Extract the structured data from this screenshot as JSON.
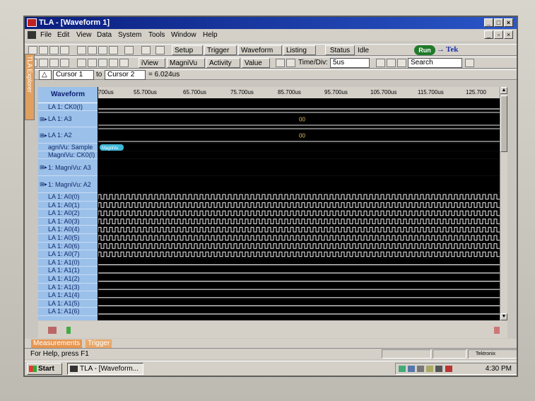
{
  "window": {
    "title": "TLA - [Waveform 1]"
  },
  "menu": [
    "File",
    "Edit",
    "View",
    "Data",
    "System",
    "Tools",
    "Window",
    "Help"
  ],
  "toolbar1": {
    "setup": "Setup",
    "trigger": "Trigger",
    "waveform": "Waveform",
    "listing": "Listing",
    "status_button": "Status",
    "status_text": "Idle",
    "run": "Run",
    "brand": "Tek"
  },
  "toolbar2": {
    "iview": "iView",
    "magnivu": "MagniVu",
    "activity": "Activity",
    "value": "Value",
    "timediv_label": "Time/Div:",
    "timediv_value": "5us",
    "search": "Search"
  },
  "toolbar3": {
    "cursor1": "Cursor 1",
    "to": "to",
    "cursor2": "Cursor 2",
    "delta": "= 6.024us"
  },
  "explorer_tab": "TLA Explorer",
  "waveform": {
    "header": "Waveform",
    "ticks": [
      "700us",
      "55.700us",
      "65.700us",
      "75.700us",
      "85.700us",
      "95.700us",
      "105.700us",
      "115.700us",
      "125.700"
    ],
    "rows": [
      {
        "label": "LA 1: CK0(I)",
        "kind": "line",
        "h": 11
      },
      {
        "label": "LA 1: A3",
        "kind": "bus",
        "value": "00",
        "h": 23,
        "expand": "⊞▸"
      },
      {
        "label": "LA 1: A2",
        "kind": "bus",
        "value": "00",
        "h": 23,
        "expand": "⊞▸"
      },
      {
        "label": "agniVu: Sample",
        "kind": "marker",
        "value": "MagniVu",
        "h": 11
      },
      {
        "label": "MagniVu: CK0(I)",
        "kind": "blank",
        "h": 11
      },
      {
        "label": "1: MagniVu: A3",
        "kind": "blank",
        "h": 24,
        "expand": "⊞▸"
      },
      {
        "label": "1: MagniVu: A2",
        "kind": "blank",
        "h": 24,
        "expand": "⊞▸"
      },
      {
        "label": "LA 1: A0(0)",
        "kind": "clock",
        "period": 8,
        "h": 11.6
      },
      {
        "label": "LA 1: A0(1)",
        "kind": "clock",
        "period": 8,
        "h": 11.6
      },
      {
        "label": "LA 1: A0(2)",
        "kind": "clock",
        "period": 8,
        "h": 11.6
      },
      {
        "label": "LA 1: A0(3)",
        "kind": "clock",
        "period": 8,
        "h": 11.6
      },
      {
        "label": "LA 1: A0(4)",
        "kind": "clock",
        "period": 8,
        "h": 11.6
      },
      {
        "label": "LA 1: A0(5)",
        "kind": "clock",
        "period": 8,
        "h": 11.6
      },
      {
        "label": "LA 1: A0(6)",
        "kind": "clock",
        "period": 8,
        "h": 11.6
      },
      {
        "label": "LA 1: A0(7)",
        "kind": "clock",
        "period": 8,
        "h": 11.6
      },
      {
        "label": "LA 1: A1(0)",
        "kind": "line",
        "h": 11.6
      },
      {
        "label": "LA 1: A1(1)",
        "kind": "line",
        "h": 11.6
      },
      {
        "label": "LA 1: A1(2)",
        "kind": "line",
        "h": 11.6
      },
      {
        "label": "LA 1: A1(3)",
        "kind": "line",
        "h": 11.6
      },
      {
        "label": "LA 1: A1(4)",
        "kind": "line",
        "h": 11.6
      },
      {
        "label": "LA 1: A1(5)",
        "kind": "line",
        "h": 11.6
      },
      {
        "label": "LA 1: A1(6)",
        "kind": "line",
        "h": 11.6
      }
    ]
  },
  "tabs": {
    "measurements": "Measurements",
    "trigger": "Trigger"
  },
  "status": {
    "help": "For Help, press F1",
    "brand_small": "Tektronix"
  },
  "taskbar": {
    "start": "Start",
    "item": "TLA - [Waveform...",
    "clock": "4:30 PM"
  }
}
